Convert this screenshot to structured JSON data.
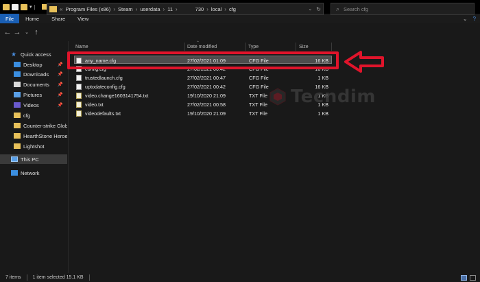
{
  "window": {
    "title": "cfg",
    "controls": [
      "—",
      "☐",
      "✕"
    ]
  },
  "ribbon": {
    "tabs": [
      "File",
      "Home",
      "Share",
      "View"
    ]
  },
  "nav": {
    "path": [
      "Program Files (x86)",
      "Steam",
      "userdata",
      "11",
      "730",
      "local",
      "cfg"
    ],
    "search_placeholder": "Search cfg"
  },
  "sidebar": {
    "items": [
      {
        "label": "Quick access",
        "icon": "star-icon"
      },
      {
        "label": "Desktop",
        "icon": "desktop-folder-icon",
        "pinned": true
      },
      {
        "label": "Downloads",
        "icon": "downloads-folder-icon",
        "pinned": true
      },
      {
        "label": "Documents",
        "icon": "documents-folder-icon",
        "pinned": true
      },
      {
        "label": "Pictures",
        "icon": "pictures-folder-icon",
        "pinned": true
      },
      {
        "label": "Videos",
        "icon": "videos-folder-icon",
        "pinned": true
      },
      {
        "label": "cfg",
        "icon": "folder-icon"
      },
      {
        "label": "Counter-strike  Glob",
        "icon": "folder-icon"
      },
      {
        "label": "HearthStone  Heroe",
        "icon": "folder-icon"
      },
      {
        "label": "Lightshot",
        "icon": "folder-icon"
      },
      {
        "label": "This PC",
        "icon": "computer-icon",
        "selected": true
      },
      {
        "label": "Network",
        "icon": "network-icon"
      }
    ]
  },
  "columns": {
    "name": "Name",
    "date": "Date modified",
    "type": "Type",
    "size": "Size"
  },
  "files": [
    {
      "name": "any_name.cfg",
      "date": "27/02/2021 01:09",
      "type": "CFG File",
      "size": "16 KB",
      "kind": "cfg",
      "selected": true
    },
    {
      "name": "config.cfg",
      "date": "27/02/2021 00:42",
      "type": "CFG File",
      "size": "16 KB",
      "kind": "cfg"
    },
    {
      "name": "trustedlaunch.cfg",
      "date": "27/02/2021 00:47",
      "type": "CFG File",
      "size": "1 KB",
      "kind": "cfg"
    },
    {
      "name": "uptodateconfig.cfg",
      "date": "27/02/2021 00:42",
      "type": "CFG File",
      "size": "16 KB",
      "kind": "cfg"
    },
    {
      "name": "video.change1603141754.txt",
      "date": "19/10/2020 21:09",
      "type": "TXT File",
      "size": "1 KB",
      "kind": "txt"
    },
    {
      "name": "video.txt",
      "date": "27/02/2021 00:58",
      "type": "TXT File",
      "size": "1 KB",
      "kind": "txt"
    },
    {
      "name": "videodefaults.txt",
      "date": "19/10/2020 21:09",
      "type": "TXT File",
      "size": "1 KB",
      "kind": "txt"
    }
  ],
  "status": {
    "count": "7 items",
    "selection": "1 item selected  15.1 KB"
  },
  "watermark": {
    "text": "Tecndim"
  },
  "colors": {
    "highlight": "#e0142b",
    "accent": "#1a5fb4",
    "folder": "#e8c15a"
  }
}
